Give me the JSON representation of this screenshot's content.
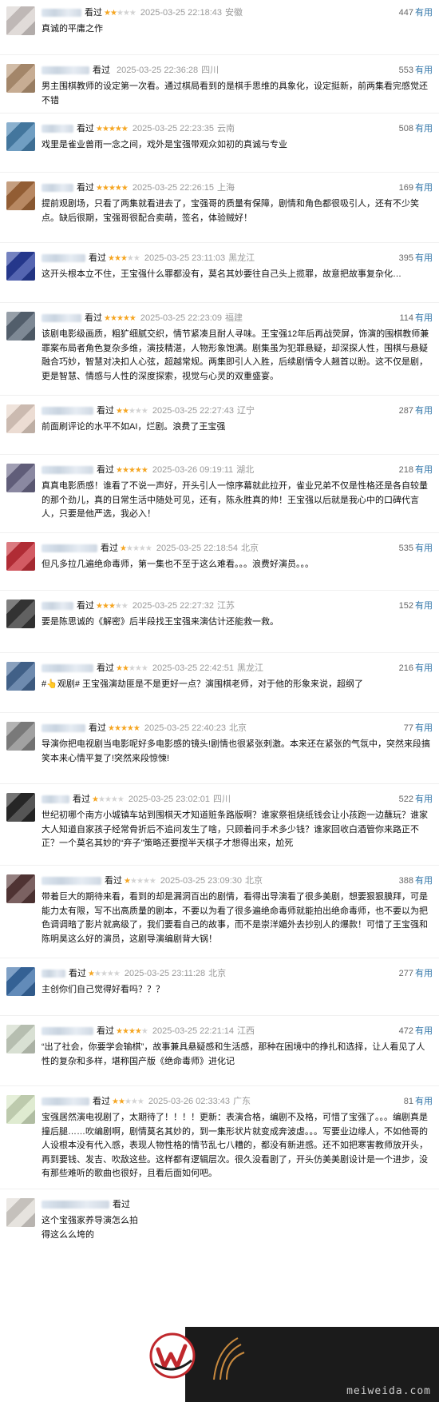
{
  "colors": {
    "star": "#f5a623",
    "star_empty": "#d3d3d3",
    "useful_link": "#3377aa",
    "meta": "#999999"
  },
  "watched_label": "看过",
  "useful_label": "有用",
  "reviews": [
    {
      "rating": 2,
      "time": "2025-03-25 22:18:43",
      "location": "安徽",
      "votes": "447",
      "content": "真诚的平庸之作",
      "avatar_color": "#d9d2cf"
    },
    {
      "rating": 0,
      "time": "2025-03-25 22:36:28",
      "location": "四川",
      "votes": "553",
      "content": "男主围棋教师的设定第一次看。通过棋局看到的是棋手思维的具象化，设定挺新，前两集看完感觉还不错",
      "avatar_color": "#b99878"
    },
    {
      "rating": 5,
      "time": "2025-03-25 22:23:35",
      "location": "云南",
      "votes": "508",
      "content": "戏里是雀业兽雨一念之间，戏外是宝强带观众如初的真诚与专业",
      "avatar_color": "#4c86b3"
    },
    {
      "rating": 5,
      "time": "2025-03-25 22:26:15",
      "location": "上海",
      "votes": "169",
      "content": "提前观剧场，只看了两集就看进去了，宝强哥的质量有保障，剧情和角色都很吸引人，还有不少笑点。缺后很期，宝强哥很配合卖萌，签名，体验贼好！",
      "avatar_color": "#a66a3b"
    },
    {
      "rating": 3,
      "time": "2025-03-25 23:11:03",
      "location": "黑龙江",
      "votes": "395",
      "content": "这开头根本立不住，王宝强什么罪都没有，莫名其妙要往自己头上揽罪，故意把故事复杂化…",
      "avatar_color": "#2a3f9e"
    },
    {
      "rating": 5,
      "time": "2025-03-25 22:23:09",
      "location": "福建",
      "votes": "114",
      "content": "该剧电影级画质，粗犷细腻交织，情节紧凑且耐人寻味。王宝强12年后再战荧屏，饰演的围棋教师兼罪案布局者角色复杂多维，演技精湛，人物形象饱满。剧集虽为犯罪悬疑，却深探人性，围棋与悬疑融合巧妙，智慧对决扣人心弦，超越常规。两集即引人入胜，后续剧情令人翘首以盼。这不仅是剧，更是智慧、情感与人性的深度探索，视觉与心灵的双重盛宴。",
      "avatar_color": "#5d6b7a"
    },
    {
      "rating": 2,
      "time": "2025-03-25 22:27:43",
      "location": "辽宁",
      "votes": "287",
      "content": "前面刷评论的水平不如AI，烂剧。浪费了王宝强",
      "avatar_color": "#e7d4c8"
    },
    {
      "rating": 5,
      "time": "2025-03-26 09:19:11",
      "location": "湖北",
      "votes": "218",
      "content": "真真电影质感！谁看了不说一声好，开头引人一惊序幕就此拉开，雀业兄弟不仅是性格还是各自较量的那个劲儿，真的日常生活中随处可见，还有，陈永胜真的帅！王宝强以后就是我心中的口碑代言人，只要是他严选，我必入！",
      "avatar_color": "#6d6a8a"
    },
    {
      "rating": 1,
      "time": "2025-03-25 22:18:54",
      "location": "北京",
      "votes": "535",
      "content": "但凡多拉几遍绝命毒师，第一集也不至于这么难看。。。浪费好演员。。。",
      "avatar_color": "#c8323c"
    },
    {
      "rating": 3,
      "time": "2025-03-25 22:27:32",
      "location": "江苏",
      "votes": "152",
      "content": "要是陈思诚的《解密》后半段找王宝强来演估计还能救一救。",
      "avatar_color": "#3a3a3a"
    },
    {
      "rating": 2,
      "time": "2025-03-25 22:42:51",
      "location": "黑龙江",
      "votes": "216",
      "content": "#👆观剧# 王宝强演劫匪是不是更好一点？演围棋老师，对于他的形象来说，超纲了",
      "avatar_color": "#4a6d9a"
    },
    {
      "rating": 5,
      "time": "2025-03-25 22:40:23",
      "location": "北京",
      "votes": "77",
      "content": "导演你把电视剧当电影呢好多电影感的镜头!剧情也很紧张刺激。本来还在紧张的气氛中，突然来段搞笑本来心情平复了!突然来段惊悚!",
      "avatar_color": "#8a8a8a"
    },
    {
      "rating": 1,
      "time": "2025-03-25 23:02:01",
      "location": "四川",
      "votes": "522",
      "content": "世纪初哪个南方小城镇车站到围棋天才知道赃条路版啊？谁家祭祖烧纸钱会让小孩跑一边蘸玩？谁家大人知道自家孩子经常骨折后不追问发生了啥，只顾着问手术多少钱？谁家回收白酒管你来路正不正？一个莫名其妙的“弃子”策略还要搅半天棋子才想得出来，尬死",
      "avatar_color": "#2b2b2b"
    },
    {
      "rating": 1,
      "time": "2025-03-25 23:09:30",
      "location": "北京",
      "votes": "388",
      "content": "带着巨大的期待来看，看到的却是漏洞百出的剧情，看得出导演看了很多美剧，想要狠狠膜拜，可是能力太有限，写不出高质量的剧本，不要以为看了很多遍绝命毒师就能拍出绝命毒师，也不要以为把色调调暗了影片就高级了，我们要看自己的故事，而不是崇洋媚外去抄别人的爆款！可惜了王宝强和陈明昊这么好的演员，这剧导演编剧背大锅！",
      "avatar_color": "#5a3a3a"
    },
    {
      "rating": 1,
      "time": "2025-03-25 23:11:28",
      "location": "北京",
      "votes": "277",
      "content": "主创你们自己觉得好看吗？？？",
      "avatar_color": "#3b6ea8"
    },
    {
      "rating": 4,
      "time": "2025-03-25 22:21:14",
      "location": "江西",
      "votes": "472",
      "content": "“出了社会，你要学会输棋”，故事兼具悬疑感和生活感，那种在困境中的挣扎和选择，让人看见了人性的复杂和多样，堪称国产版《绝命毒师》进化记",
      "avatar_color": "#cfd8c8"
    },
    {
      "rating": 2,
      "time": "2025-03-26 02:33:43",
      "location": "广东",
      "votes": "81",
      "content": "宝强居然演电视剧了，太期待了！！！！更新：表演合格，编剧不及格，可惜了宝强了。。。编剧真是撞后腿……吹编剧啊，剧情莫名其妙的，到一集形状片就变成奔波虐。。。写要业边缘人，不如他哥的人设根本没有代入感，表现人物性格的情节乱七八糟的，都没有新进感。还不如把寒害教师放开头，再到要钱、发吉、吹敌这些。这样都有逻辑层次。很久没看剧了，开头仿美美剧设计是一个进步，没有那些难听的歌曲也很好，且看后面如何吧。",
      "avatar_color": "#d7e6c5"
    },
    {
      "rating": 0,
      "time": "",
      "location": "",
      "votes": "",
      "content": "这个宝强家养导演怎么拍得这么么垮的",
      "avatar_color": "#e0dcd6"
    }
  ],
  "watermark": {
    "text": "meiweida.com"
  }
}
